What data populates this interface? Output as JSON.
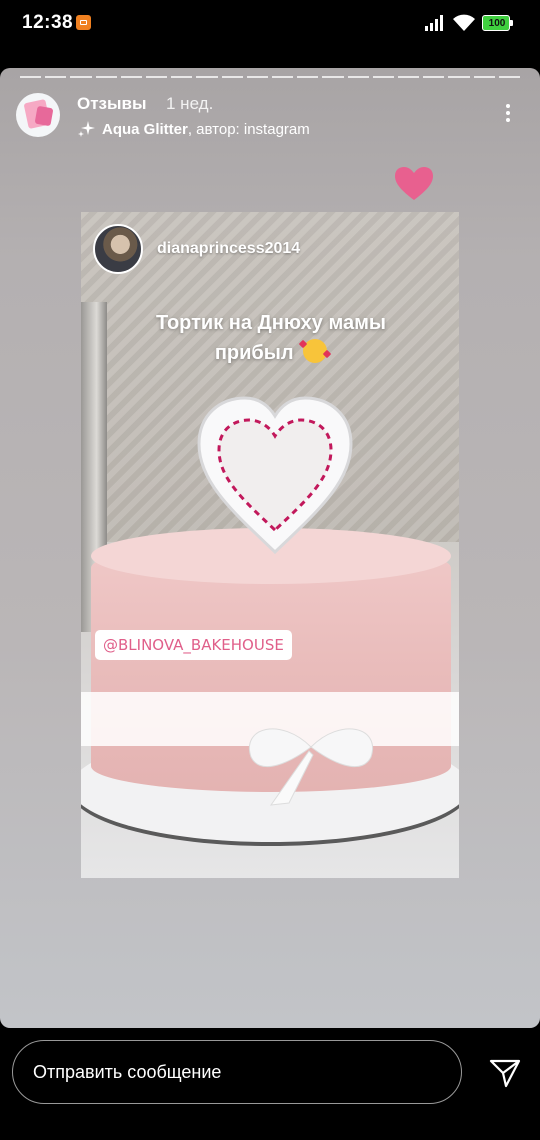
{
  "status_bar": {
    "time": "12:38",
    "battery_level": "100",
    "battery_color": "#3fcf3f",
    "notification_color": "#f08020"
  },
  "story": {
    "segment_count": 20,
    "account_name": "Отзывы",
    "time_ago": "1 нед.",
    "music": {
      "title": "Aqua Glitter",
      "author_text": ", автор: instagram"
    },
    "reaction_color": "#e8608f",
    "embedded_post": {
      "username": "dianaprincess2014",
      "caption": "Тортик на Днюху мамы прибыл",
      "mention": "@BLINOVA_BAKEHOUSE"
    }
  },
  "reply_bar": {
    "placeholder": "Отправить сообщение"
  },
  "icons": [
    "notification-icon",
    "signal-icon",
    "wifi-icon",
    "battery-icon",
    "sparkle-icon",
    "more-icon",
    "heart-icon",
    "smiling-face-with-hearts-icon",
    "send-icon"
  ]
}
